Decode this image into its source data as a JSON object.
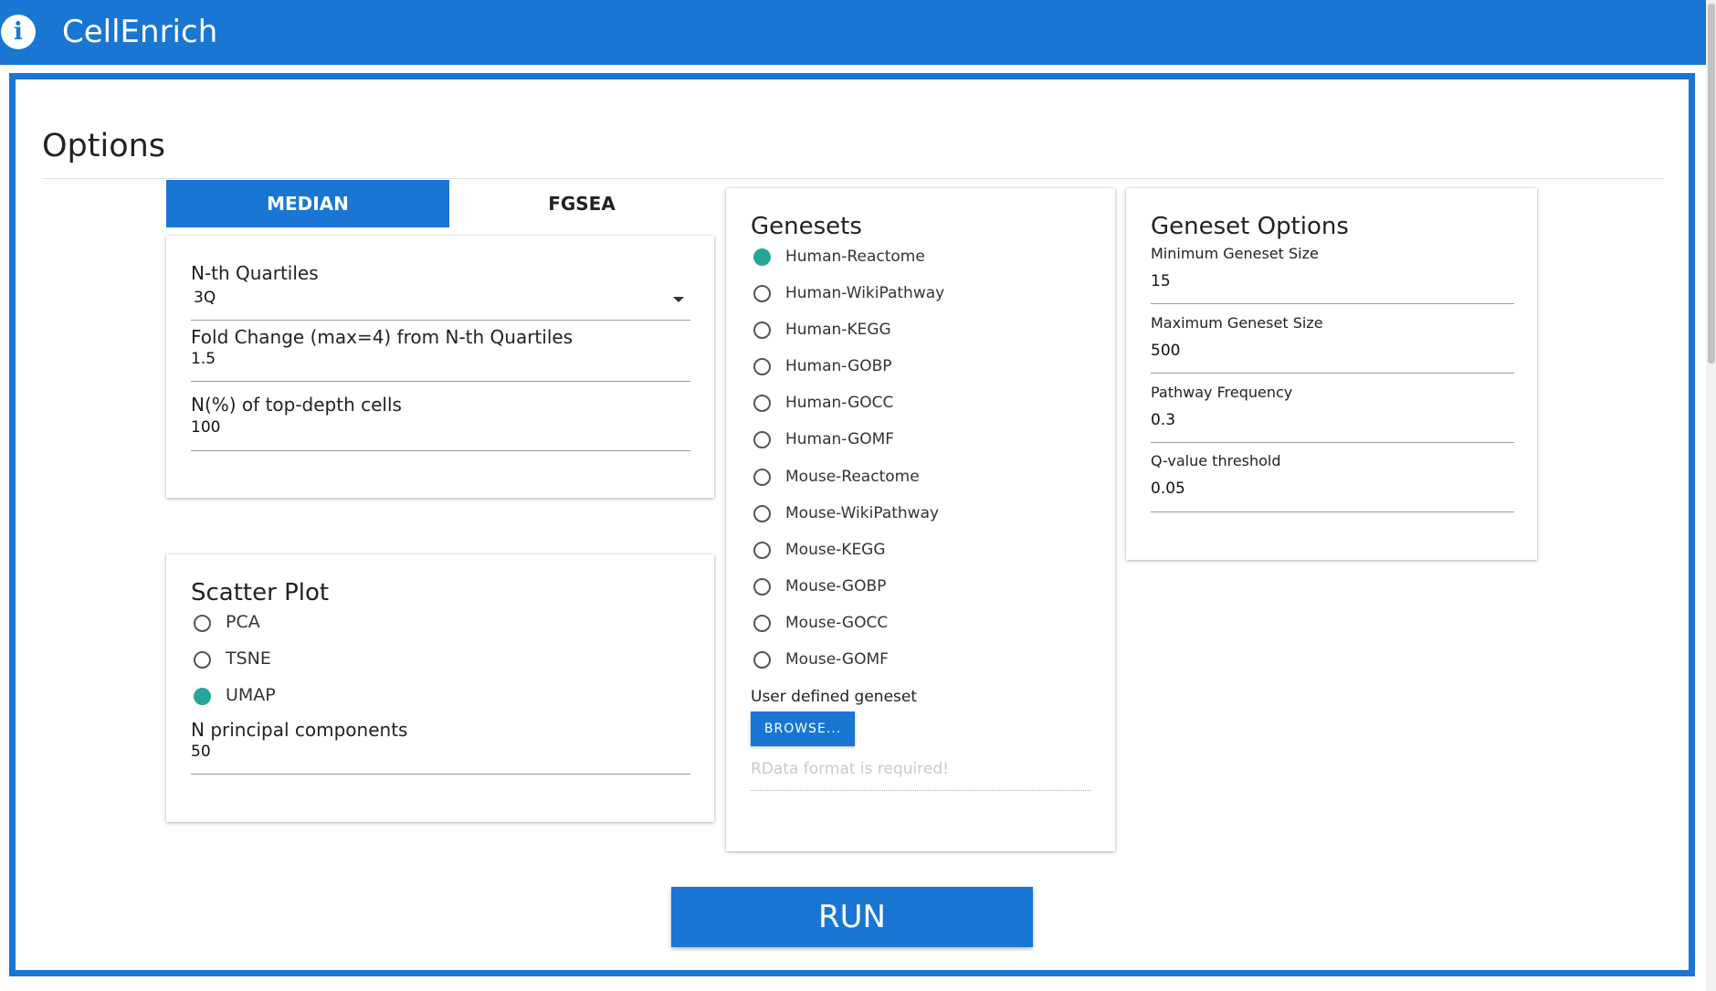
{
  "app": {
    "title": "CellEnrich",
    "info_icon": "info-icon"
  },
  "page": {
    "title": "Options"
  },
  "tabs": [
    {
      "label": "MEDIAN",
      "active": true
    },
    {
      "label": "FGSEA",
      "active": false
    }
  ],
  "median": {
    "quartiles": {
      "label": "N-th Quartiles",
      "value": "3Q"
    },
    "fold_change": {
      "label": "Fold Change (max=4) from N-th Quartiles",
      "value": "1.5"
    },
    "top_depth": {
      "label": "N(%) of top-depth cells",
      "value": "100"
    }
  },
  "scatter": {
    "title": "Scatter Plot",
    "options": [
      {
        "label": "PCA",
        "checked": false
      },
      {
        "label": "TSNE",
        "checked": false
      },
      {
        "label": "UMAP",
        "checked": true
      }
    ],
    "principal_components": {
      "label": "N principal components",
      "value": "50"
    }
  },
  "genesets": {
    "title": "Genesets",
    "options": [
      {
        "label": "Human-Reactome",
        "checked": true
      },
      {
        "label": "Human-WikiPathway",
        "checked": false
      },
      {
        "label": "Human-KEGG",
        "checked": false
      },
      {
        "label": "Human-GOBP",
        "checked": false
      },
      {
        "label": "Human-GOCC",
        "checked": false
      },
      {
        "label": "Human-GOMF",
        "checked": false
      },
      {
        "label": "Mouse-Reactome",
        "checked": false
      },
      {
        "label": "Mouse-WikiPathway",
        "checked": false
      },
      {
        "label": "Mouse-KEGG",
        "checked": false
      },
      {
        "label": "Mouse-GOBP",
        "checked": false
      },
      {
        "label": "Mouse-GOCC",
        "checked": false
      },
      {
        "label": "Mouse-GOMF",
        "checked": false
      }
    ],
    "user_defined": {
      "label": "User defined geneset",
      "browse_label": "BROWSE...",
      "placeholder": "RData format is required!"
    }
  },
  "geneset_options": {
    "title": "Geneset Options",
    "fields": [
      {
        "label": "Minimum Geneset Size",
        "value": "15"
      },
      {
        "label": "Maximum Geneset Size",
        "value": "500"
      },
      {
        "label": "Pathway Frequency",
        "value": "0.3"
      },
      {
        "label": "Q-value threshold",
        "value": "0.05"
      }
    ]
  },
  "run": {
    "label": "RUN"
  },
  "colors": {
    "primary": "#1976d2",
    "radio_checked": "#26a69a"
  }
}
